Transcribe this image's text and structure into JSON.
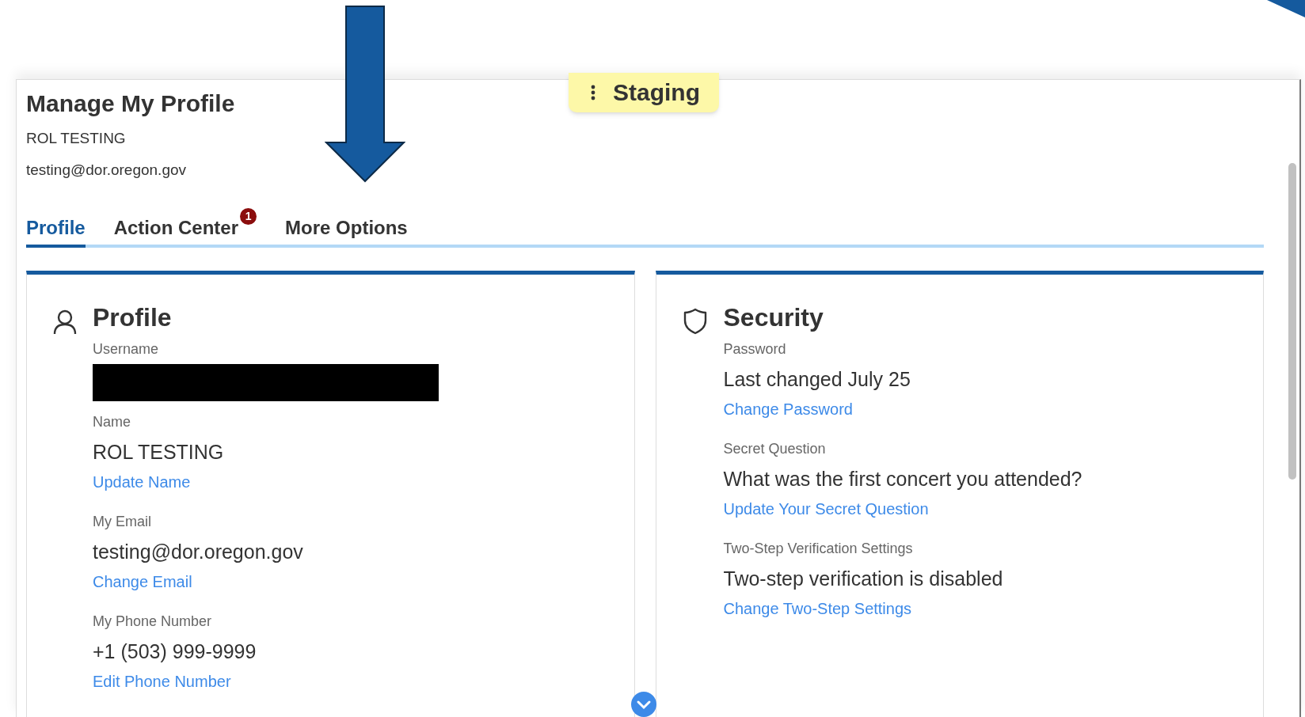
{
  "page": {
    "title": "Manage My Profile",
    "user_name": "ROL TESTING",
    "user_email": "testing@dor.oregon.gov"
  },
  "environment_badge": {
    "label": "Staging"
  },
  "tabs": [
    {
      "label": "Profile",
      "selected": true
    },
    {
      "label": "Action Center",
      "selected": false,
      "badge": "1"
    },
    {
      "label": "More Options",
      "selected": false
    }
  ],
  "cards": [
    {
      "kind": "profile",
      "title": "Profile",
      "sections": [
        {
          "label": "Username",
          "redacted": true
        },
        {
          "label": "Name",
          "value": "ROL TESTING",
          "link": "Update Name"
        },
        {
          "label": "My Email",
          "value": "testing@dor.oregon.gov",
          "link": "Change Email"
        },
        {
          "label": "My Phone Number",
          "value": "+1 (503) 999-9999",
          "link": "Edit Phone Number"
        }
      ]
    },
    {
      "kind": "security",
      "title": "Security",
      "sections": [
        {
          "label": "Password",
          "value": "Last changed July 25",
          "link": "Change Password"
        },
        {
          "label": "Secret Question",
          "value": "What was the first concert you attended?",
          "link": "Update Your Secret Question"
        },
        {
          "label": "Two-Step Verification Settings",
          "value": "Two-step verification is disabled",
          "link": "Change Two-Step Settings"
        }
      ]
    }
  ]
}
